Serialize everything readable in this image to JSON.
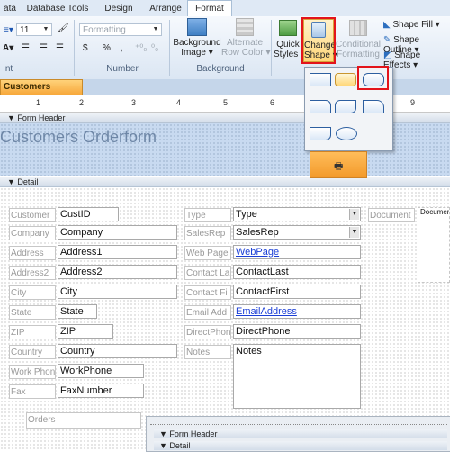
{
  "ribbon_tabs": [
    "ata",
    "Database Tools",
    "Design",
    "Arrange",
    "Format"
  ],
  "active_tab": "Format",
  "font_group": {
    "size": "11",
    "label": "nt"
  },
  "number_group": {
    "format": "Formatting",
    "symbols": [
      "$",
      "%",
      ","
    ],
    "label": "Number"
  },
  "background_group": {
    "background_image": "Background\nImage ▾",
    "alternate_row_color": "Alternate\nRow Color ▾",
    "label": "Background"
  },
  "control_formatting": {
    "quick_styles": "Quick\nStyles ▾",
    "change_shape": "Change\nShape ▾",
    "conditional_formatting": "Conditional\nFormatting",
    "shape_fill": "Shape Fill ▾",
    "shape_outline": "Shape Outline ▾",
    "shape_effects": "Shape Effects ▾"
  },
  "object_tab": "Customers Orderform",
  "ruler_numbers": [
    "1",
    "2",
    "3",
    "4",
    "5",
    "6",
    "7",
    "8",
    "9"
  ],
  "sections": {
    "form_header": "Form Header",
    "detail": "Detail"
  },
  "form_title": "Customers Orderform",
  "fields_left": [
    {
      "label": "Customer",
      "value": "CustID"
    },
    {
      "label": "Company",
      "value": "Company"
    },
    {
      "label": "Address",
      "value": "Address1"
    },
    {
      "label": "Address2",
      "value": "Address2"
    },
    {
      "label": "City",
      "value": "City"
    },
    {
      "label": "State",
      "value": "State"
    },
    {
      "label": "ZIP",
      "value": "ZIP"
    },
    {
      "label": "Country",
      "value": "Country"
    },
    {
      "label": "Work Phon",
      "value": "WorkPhone"
    },
    {
      "label": "Fax",
      "value": "FaxNumber"
    }
  ],
  "fields_right": [
    {
      "label": "Type",
      "value": "Type"
    },
    {
      "label": "SalesRep",
      "value": "SalesRep"
    },
    {
      "label": "Web Page",
      "value": "WebPage"
    },
    {
      "label": "Contact La",
      "value": "ContactLast"
    },
    {
      "label": "Contact Fi",
      "value": "ContactFirst"
    },
    {
      "label": "Email Add",
      "value": "EmailAddress"
    },
    {
      "label": "DirectPhon",
      "value": "DirectPhone"
    },
    {
      "label": "Notes",
      "value": "Notes"
    }
  ],
  "document": {
    "label": "Document",
    "value": "Documen"
  },
  "orders_label": "Orders",
  "subform_sections": {
    "form_header": "Form Header",
    "detail": "Detail"
  },
  "colors": {
    "highlight": "#e3141b",
    "header_band": "#c8daf0",
    "active_doc_tab": "#f7a83b",
    "link": "#1b3fd6"
  }
}
